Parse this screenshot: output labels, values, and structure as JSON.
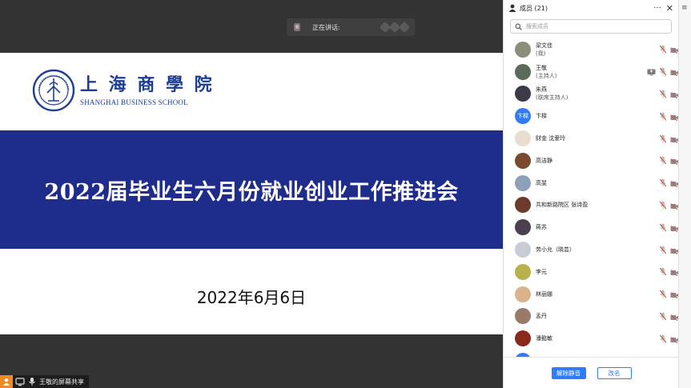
{
  "stage": {
    "speaking_label": "正在讲话:",
    "slide": {
      "logo_cn": "上 海 商 學 院",
      "logo_en": "SHANGHAI BUSINESS SCHOOL",
      "title": "2022届毕业生六月份就业创业工作推进会",
      "date": "2022年6月6日"
    },
    "share_label": "王敬的屏幕共享"
  },
  "panel": {
    "title": "成员 (21)",
    "more_icon": "more-icon",
    "close_icon": "close-icon",
    "search_placeholder": "搜索成员",
    "members": [
      {
        "name": "梁文佳",
        "sub": "(我)",
        "avatar_color": "#8a8f7a",
        "icons": [
          "mic-muted",
          "camera-off"
        ]
      },
      {
        "name": "王敬",
        "sub": "(主持人)",
        "avatar_color": "#5b6b5a",
        "icons": [
          "screen-share",
          "mic-muted",
          "camera-off"
        ]
      },
      {
        "name": "朱燕",
        "sub": "(联席主持人)",
        "avatar_color": "#3a3a48",
        "icons": [
          "mic-muted",
          "camera-off"
        ]
      },
      {
        "name": "卞樑",
        "sub": "",
        "avatar_color": "#2f7cf6",
        "avatar_text": "卞樑",
        "icons": [
          "mic-muted",
          "camera-off"
        ]
      },
      {
        "name": "财金 沈爱玲",
        "sub": "",
        "avatar_color": "#e8ddd0",
        "icons": [
          "mic-muted",
          "camera-off"
        ]
      },
      {
        "name": "高洁静",
        "sub": "",
        "avatar_color": "#7a4a2e",
        "icons": [
          "mic-muted",
          "camera-off"
        ]
      },
      {
        "name": "高斐",
        "sub": "",
        "avatar_color": "#8da0b8",
        "icons": [
          "mic-muted",
          "camera-off"
        ]
      },
      {
        "name": "共和新路院区 张诗盈",
        "sub": "",
        "avatar_color": "#6b3a2a",
        "icons": [
          "mic-muted",
          "camera-off"
        ]
      },
      {
        "name": "蒋苏",
        "sub": "",
        "avatar_color": "#4a4050",
        "icons": [
          "mic-muted",
          "camera-off"
        ]
      },
      {
        "name": "劳小允（晓芸）",
        "sub": "",
        "avatar_color": "#c9ccd4",
        "icons": [
          "mic-muted",
          "camera-off"
        ]
      },
      {
        "name": "李元",
        "sub": "",
        "avatar_color": "#b9b24a",
        "icons": [
          "mic-muted",
          "camera-off"
        ]
      },
      {
        "name": "林丽娜",
        "sub": "",
        "avatar_color": "#d9b48a",
        "icons": [
          "mic-muted",
          "camera-off"
        ]
      },
      {
        "name": "孟丹",
        "sub": "",
        "avatar_color": "#9a7a6a",
        "icons": [
          "mic-muted",
          "camera-off"
        ]
      },
      {
        "name": "潘懿敏",
        "sub": "",
        "avatar_color": "#8a2a1a",
        "icons": [
          "mic-muted",
          "camera-off"
        ]
      },
      {
        "name": "",
        "sub": "",
        "avatar_color": "#2f7cf6",
        "icons": [
          "mic-muted",
          "camera-off"
        ]
      }
    ],
    "footer": {
      "mute_all_label": "解除静音",
      "rename_label": "改名"
    }
  },
  "colors": {
    "accent": "#2f7cf6",
    "slide_band": "#1e2c8c",
    "mic_muted": "#d9534f"
  }
}
